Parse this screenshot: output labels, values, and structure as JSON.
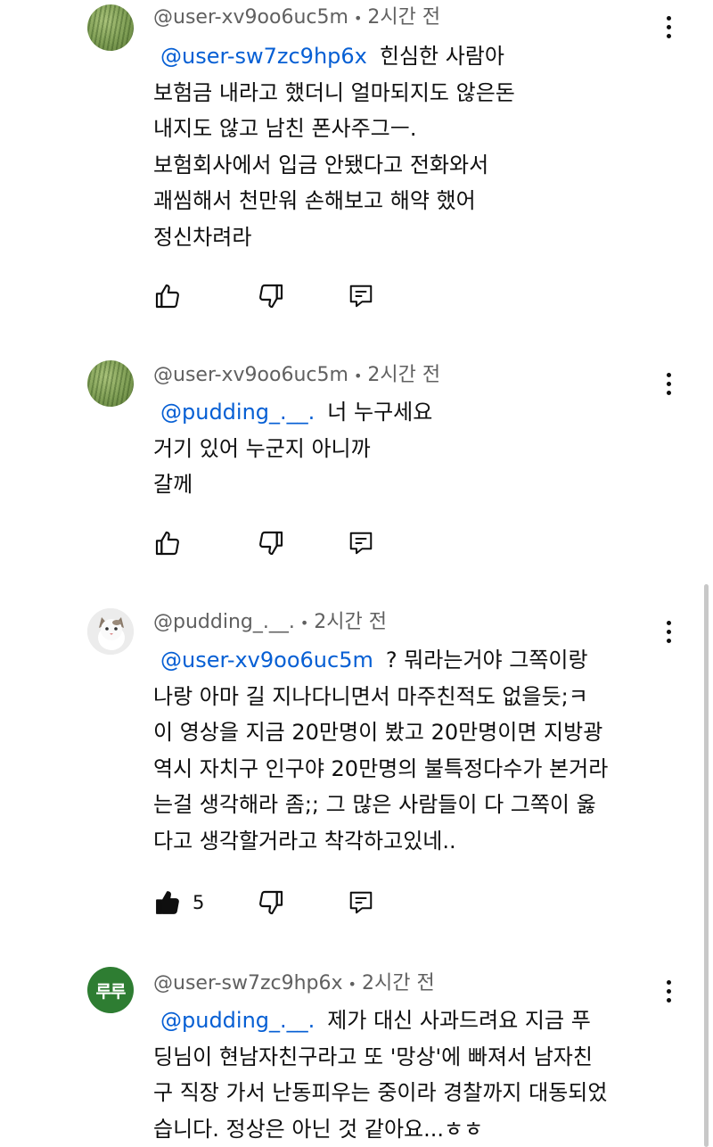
{
  "comments": [
    {
      "author": "@user-xv9oo6uc5m",
      "time": "2시간 전",
      "avatar": "grass-avatar",
      "mention": "@user-sw7zc9hp6x",
      "lines": [
        "힌심한 사람아",
        "보험금 내라고 했더니  얼마되지도 않은돈",
        "내지도 않고 남친 폰사주그ㅡ.",
        "보험회사에서 입금 안됐다고 전화와서",
        "괘씸해서 천만워 손해보고 해약 했어",
        "정신차려라"
      ],
      "likes": ""
    },
    {
      "author": "@user-xv9oo6uc5m",
      "time": "2시간 전",
      "avatar": "grass-avatar",
      "mention": "@pudding_.__.",
      "lines": [
        "너 누구세요",
        "거기 있어 누군지 아니까",
        "갈께"
      ],
      "likes": ""
    },
    {
      "author": "@pudding_.__.",
      "time": "2시간 전",
      "avatar": "cat-avatar",
      "mention": "@user-xv9oo6uc5m",
      "lines": [
        "? 뭐라는거야 그쪽이랑",
        "나랑 아마 길 지나다니면서 마주친적도 없을듯;ㅋ",
        "이 영상을 지금 20만명이 봤고 20만명이면 지방광",
        "역시 자치구 인구야 20만명의 불특정다수가 본거라",
        "는걸 생각해라 좀;; 그 많은 사람들이 다 그쪽이 옳",
        "다고 생각할거라고 착각하고있네.."
      ],
      "likes": "5"
    },
    {
      "author": "@user-sw7zc9hp6x",
      "time": "2시간 전",
      "avatar": "루루",
      "mention": "@pudding_.__.",
      "lines": [
        "제가 대신 사과드려요 지금 푸",
        "딩님이 현남자친구라고 또 '망상'에 빠져서 남자친",
        "구 직장 가서 난동피우는 중이라 경찰까지 대동되었",
        "습니다. 정상은 아닌 것 같아요...ㅎㅎ"
      ],
      "likes": ""
    }
  ],
  "icons": {
    "like": "thumbs-up-icon",
    "dislike": "thumbs-down-icon",
    "reply": "reply-icon",
    "more": "more-vert-icon"
  },
  "colors": {
    "mention": "#065fd4",
    "meta": "#606060",
    "text": "#0f0f0f"
  }
}
